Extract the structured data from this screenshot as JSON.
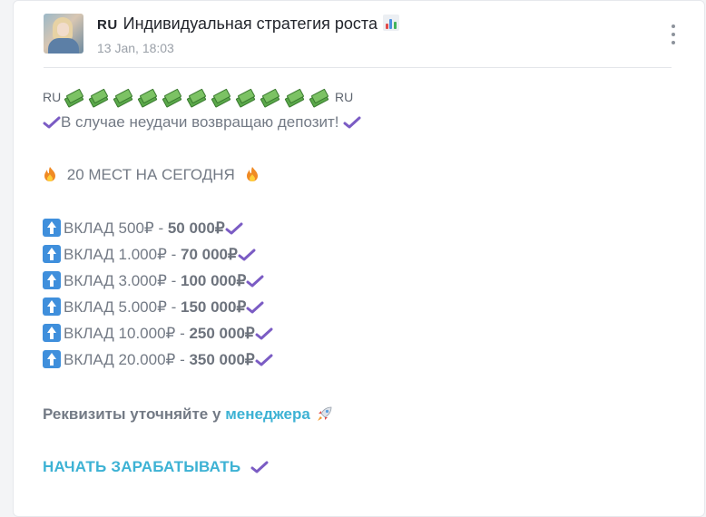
{
  "post": {
    "title_flag": "RU",
    "title": "Индивидуальная стратегия роста",
    "title_icon": "bar-chart-icon",
    "date": "13 Jan, 18:03",
    "menu_icon": "more-vertical-icon"
  },
  "content": {
    "flag_left": "RU",
    "flag_right": "RU",
    "money_icon_count": 11,
    "guarantee_text": "В случае неудачи возвращаю депозит!",
    "places_text": "20 МЕСТ НА СЕГОДНЯ",
    "deposits": [
      {
        "prefix": "ВКЛАД 500₽ - ",
        "result": "50 000₽"
      },
      {
        "prefix": "ВКЛАД 1.000₽ - ",
        "result": "70 000₽"
      },
      {
        "prefix": "ВКЛАД 3.000₽ - ",
        "result": "100 000₽"
      },
      {
        "prefix": "ВКЛАД 5.000₽ - ",
        "result": "150 000₽"
      },
      {
        "prefix": "ВКЛАД 10.000₽ - ",
        "result": "250 000₽"
      },
      {
        "prefix": "ВКЛАД 20.000₽ - ",
        "result": "350 000₽"
      }
    ],
    "requisites_text": "Реквизиты уточняйте у",
    "manager_link": "менеджера",
    "cta_label": "НАЧАТЬ ЗАРАБАТЫВАТЬ"
  },
  "colors": {
    "accent_link": "#3db2d4",
    "check_purple": "#7b5cc4",
    "text_gray": "#737a85"
  }
}
